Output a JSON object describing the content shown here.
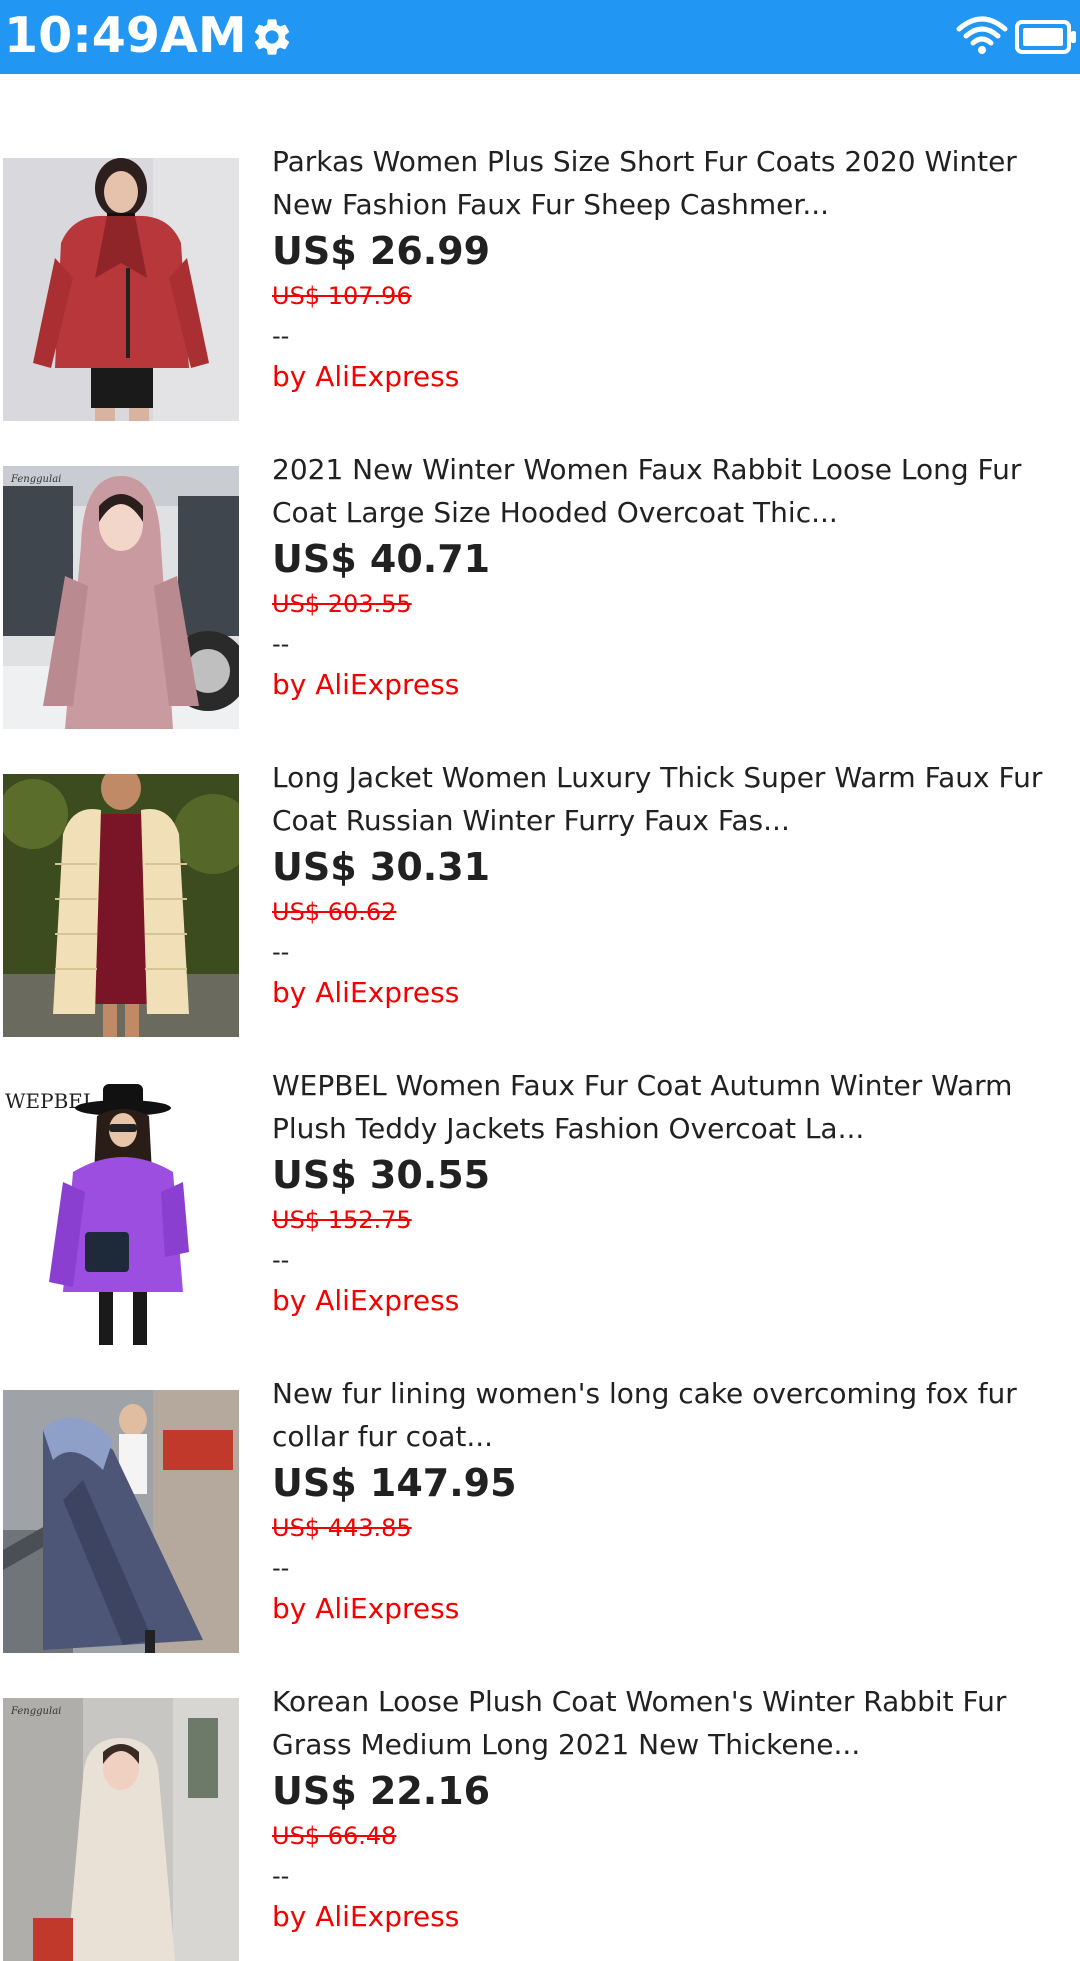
{
  "status_bar": {
    "time": "10:49AM",
    "background": "#2196f3",
    "icons": [
      "gear-icon",
      "wifi-icon",
      "battery-icon"
    ]
  },
  "colors": {
    "accent_red": "#f40000",
    "text_dark": "#212121"
  },
  "products": [
    {
      "title": "Parkas Women Plus Size Short Fur Coats 2020 Winter\nNew Fashion Faux Fur Sheep Cashmer...",
      "price": "US$ 26.99",
      "old_price": "US$ 107.96",
      "rating": "--",
      "seller": "by AliExpress",
      "image": "red-fur-coat-photo"
    },
    {
      "title": "2021 New Winter Women Faux Rabbit Loose Long Fur\nCoat Large Size Hooded Overcoat Thic...",
      "price": "US$ 40.71",
      "old_price": "US$ 203.55",
      "rating": "--",
      "seller": "by AliExpress",
      "image": "pink-hooded-coat-photo",
      "image_watermark": "Fenggulai"
    },
    {
      "title": "Long Jacket Women Luxury Thick Super Warm Faux Fur\nCoat Russian Winter Furry Faux Fas...",
      "price": "US$ 30.31",
      "old_price": "US$ 60.62",
      "rating": "--",
      "seller": "by AliExpress",
      "image": "cream-fur-coat-photo"
    },
    {
      "title": "WEPBEL Women Faux Fur Coat Autumn Winter Warm\nPlush Teddy Jackets Fashion Overcoat La...",
      "price": "US$ 30.55",
      "old_price": "US$ 152.75",
      "rating": "--",
      "seller": "by AliExpress",
      "image": "purple-fur-coat-photo",
      "image_watermark": "WEPBEL"
    },
    {
      "title": "New fur lining women's long cake overcoming fox fur\ncollar fur coat...",
      "price": "US$ 147.95",
      "old_price": "US$ 443.85",
      "rating": "--",
      "seller": "by AliExpress",
      "image": "navy-parka-photo"
    },
    {
      "title": "Korean Loose Plush Coat Women's Winter Rabbit Fur\nGrass Medium Long 2021 New Thickene...",
      "price": "US$ 22.16",
      "old_price": "US$ 66.48",
      "rating": "--",
      "seller": "by AliExpress",
      "image": "beige-plush-coat-photo",
      "image_watermark": "Fenggulai"
    }
  ]
}
